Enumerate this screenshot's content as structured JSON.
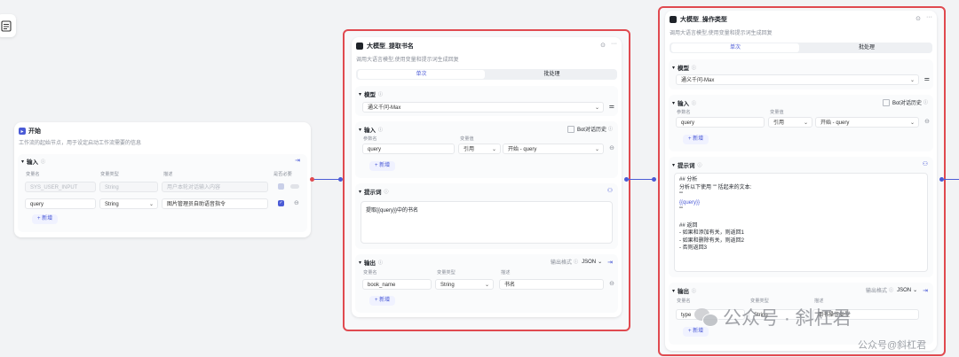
{
  "start_node": {
    "title": "开始",
    "description": "工作流的起始节点，用于设定启动工作流需要的信息",
    "section_label": "输入",
    "headers": [
      "变量名",
      "变量类型",
      "描述",
      "是否必要"
    ],
    "rows": [
      {
        "name": "SYS_USER_INPUT",
        "type": "String",
        "desc": "用户本轮对话输入内容"
      },
      {
        "name": "query",
        "type": "String",
        "desc": "图片管理员自助语音指令"
      }
    ],
    "add_label": "新增"
  },
  "llm1": {
    "title": "大模型_提取书名",
    "description": "调用大语言模型,使用变量和提示词生成回复",
    "tabs": [
      "单次",
      "批处理"
    ],
    "model_label": "模型",
    "model_value": "通义千问-Max",
    "input_label": "输入",
    "bot_history": "Bot对话历史",
    "input_headers": [
      "参数名",
      "变量值"
    ],
    "input_row": {
      "name": "query",
      "ref": "引用",
      "value": "开始 - query"
    },
    "add_label": "新增",
    "prompt_label": "提示词",
    "prompt_text": "提取{{query}}中的书名",
    "output_label": "输出",
    "output_format_label": "输出格式",
    "output_format": "JSON",
    "output_headers": [
      "变量名",
      "变量类型",
      "描述"
    ],
    "output_row": {
      "name": "book_name",
      "type": "String",
      "desc": "书名"
    }
  },
  "llm2": {
    "title": "大模型_操作类型",
    "description": "调用大语言模型,使用变量和提示词生成回复",
    "tabs": [
      "单次",
      "批处理"
    ],
    "model_label": "模型",
    "model_value": "通义千问-Max",
    "input_label": "输入",
    "bot_history": "Bot对话历史",
    "input_headers": [
      "参数名",
      "变量值"
    ],
    "input_row": {
      "name": "query",
      "ref": "引用",
      "value": "开始 - query"
    },
    "add_label": "新增",
    "prompt_label": "提示词",
    "prompt_lines": [
      "## 分析",
      "分析以下使用 \"\" 括起来的文本:",
      "\"\"",
      "{{query}}",
      "\"\"",
      "",
      "## 返回",
      "- 如果和添加有关，则返回1",
      "- 如果和删除有关，则返回2",
      "- 否则返回3"
    ],
    "output_label": "输出",
    "output_format_label": "输出格式",
    "output_format": "JSON",
    "output_headers": [
      "变量名",
      "变量类型",
      "描述"
    ],
    "output_row": {
      "name": "type",
      "type": "String",
      "desc": "图书操作类型"
    }
  },
  "watermark": {
    "main": "公众号 · 斜杠君",
    "sub": "公众号@斜杠君"
  },
  "colors": {
    "accent": "#4b5bd6",
    "highlight": "#e04a50"
  }
}
